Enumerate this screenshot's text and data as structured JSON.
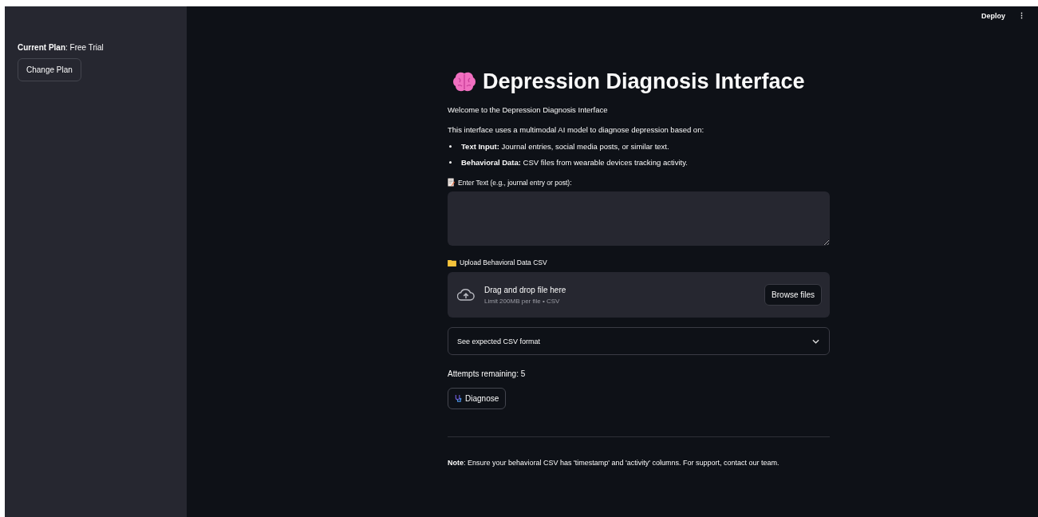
{
  "sidebar": {
    "plan_label": "**Current Plan**: Free Trial",
    "change_plan_button": "Change Plan"
  },
  "header": {
    "deploy": "Deploy",
    "menu": "⋮"
  },
  "title": "Depression Diagnosis Interface",
  "intro": [
    "Welcome to the Depression Diagnosis Interface",
    "This interface uses a multimodal AI model to diagnose depression based on:"
  ],
  "bullets": [
    "**Text Input:** Journal entries, social media posts, or similar text.",
    "**Behavioral Data:** CSV files from wearable devices tracking activity."
  ],
  "text_field": {
    "label": "Enter Text (e.g., journal entry or post):"
  },
  "uploader": {
    "label": "Upload Behavioral Data CSV",
    "drop_text": "Drag and drop file here",
    "limit_text": "Limit 200MB per file • CSV",
    "browse_button": "Browse files"
  },
  "expander": {
    "label": "See expected CSV format",
    "expanded": false
  },
  "attempts": "Attempts remaining: 5",
  "diagnose_button": "Diagnose",
  "note": "**Note**: Ensure your behavioral CSV has 'timestamp' and 'activity' columns. For support, contact our team."
}
